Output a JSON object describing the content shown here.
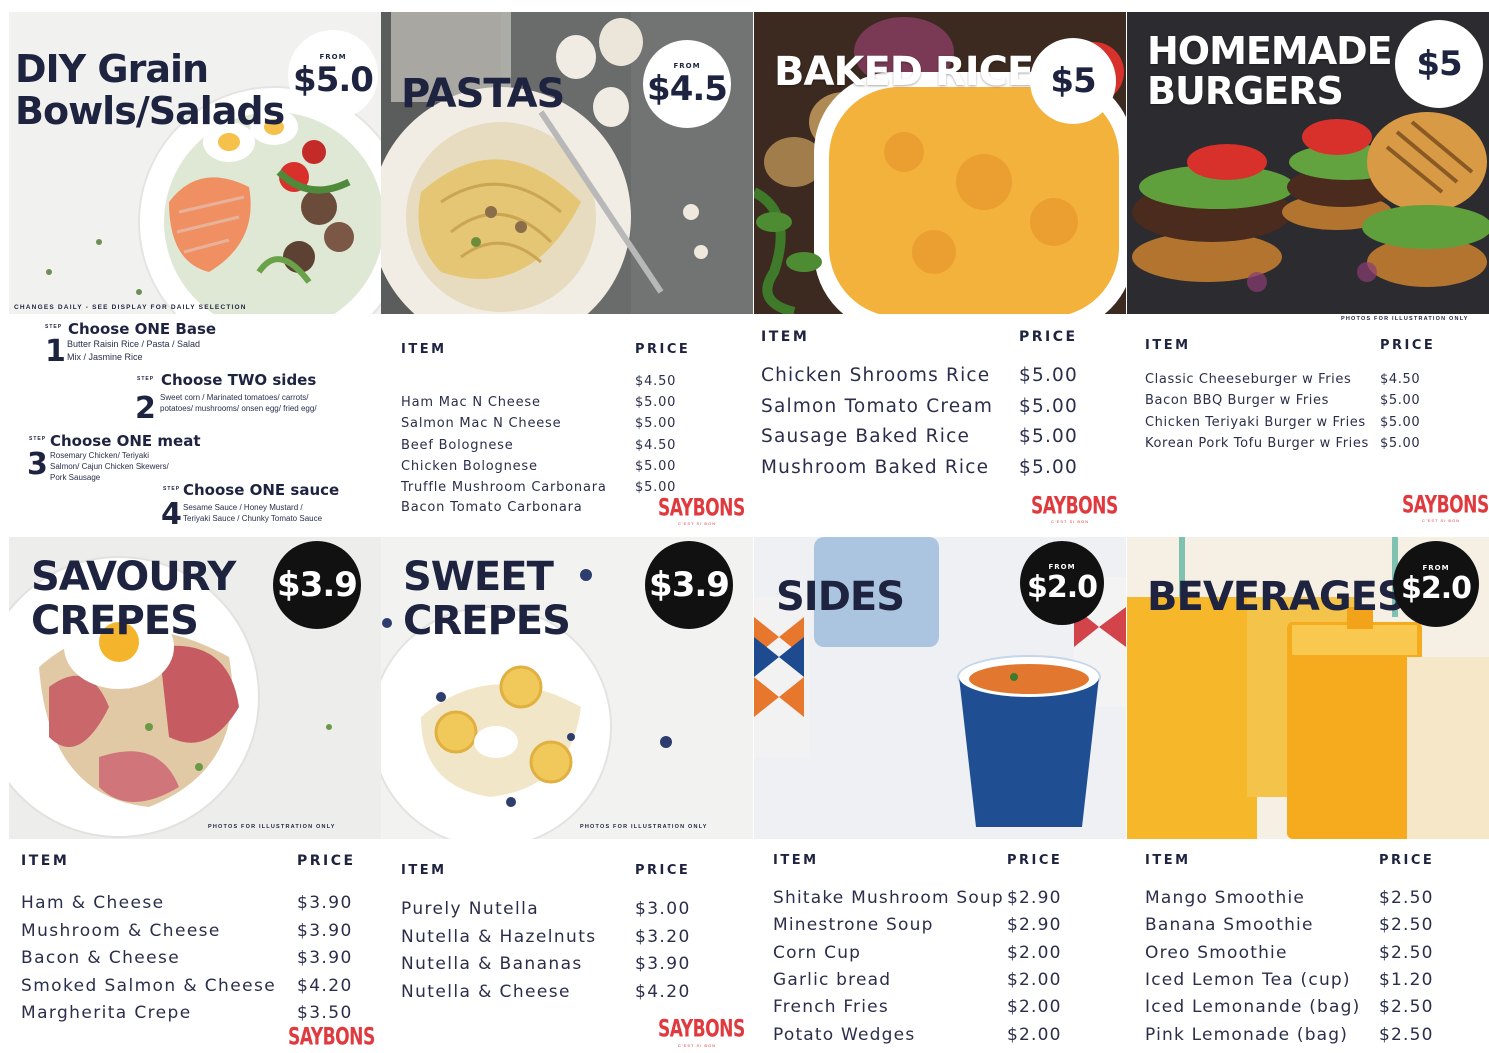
{
  "colors": {
    "navy": "#1e2340",
    "brand_red": "#e03a3e",
    "badge_black": "#111111"
  },
  "brand": {
    "name": "SAYBONS",
    "tagline": "C'EST SI BON"
  },
  "panels": {
    "grain_bowls": {
      "title_line1": "DIY Grain",
      "title_line2": "Bowls/Salads",
      "badge_from": "FROM",
      "badge_price": "$5.0",
      "caption": "CHANGES DAILY - SEE DISPLAY FOR DAILY SELECTION",
      "step_label": "STEP",
      "steps": [
        {
          "num": "1",
          "title": "Choose ONE Base",
          "desc_line1": "Butter Raisin Rice / Pasta  / Salad",
          "desc_line2": "Mix / Jasmine Rice"
        },
        {
          "num": "2",
          "title": "Choose TWO sides",
          "desc_line1": "Sweet corn / Marinated tomatoes/ carrots/",
          "desc_line2": "potatoes/ mushrooms/ onsen egg/ fried egg/"
        },
        {
          "num": "3",
          "title": "Choose ONE meat",
          "desc_line1": "Rosemary Chicken/ Teriyaki",
          "desc_line2": "Salmon/ Cajun Chicken Skewers/",
          "desc_line3": "Pork Sausage"
        },
        {
          "num": "4",
          "title": "Choose ONE sauce",
          "desc_line1": "Sesame Sauce / Honey Mustard /",
          "desc_line2": "Teriyaki Sauce / Chunky Tomato Sauce"
        }
      ]
    },
    "pastas": {
      "title": "PASTAS",
      "badge_from": "FROM",
      "badge_price": "$4.5",
      "item_header": "ITEM",
      "price_header": "PRICE",
      "items": [
        {
          "name": "",
          "price": "$4.50"
        },
        {
          "name": "Ham Mac N Cheese",
          "price": "$5.00"
        },
        {
          "name": "Salmon Mac N Cheese",
          "price": "$5.00"
        },
        {
          "name": "Beef Bolognese",
          "price": "$4.50"
        },
        {
          "name": "Chicken Bolognese",
          "price": "$5.00"
        },
        {
          "name": "Truffle Mushroom Carbonara",
          "price": "$5.00"
        },
        {
          "name": "Bacon Tomato Carbonara",
          "price": ""
        }
      ]
    },
    "baked_rice": {
      "title": "BAKED RICE",
      "badge_price": "$5",
      "item_header": "ITEM",
      "price_header": "PRICE",
      "items": [
        {
          "name": "Chicken Shrooms Rice",
          "price": "$5.00"
        },
        {
          "name": "Salmon Tomato Cream",
          "price": "$5.00"
        },
        {
          "name": "Sausage Baked Rice",
          "price": "$5.00"
        },
        {
          "name": "Mushroom Baked Rice",
          "price": "$5.00"
        }
      ]
    },
    "burgers": {
      "title_line1": "HOMEMADE",
      "title_line2": "BURGERS",
      "badge_price": "$5",
      "caption": "PHOTOS FOR ILLUSTRATION ONLY",
      "item_header": "ITEM",
      "price_header": "PRICE",
      "items": [
        {
          "name": "Classic Cheeseburger w Fries",
          "price": "$4.50"
        },
        {
          "name": "Bacon BBQ Burger w Fries",
          "price": "$5.00"
        },
        {
          "name": "Chicken Teriyaki Burger w Fries",
          "price": "$5.00"
        },
        {
          "name": "Korean Pork Tofu Burger w Fries",
          "price": "$5.00"
        }
      ]
    },
    "savoury_crepes": {
      "title_line1": "SAVOURY",
      "title_line2": "CREPES",
      "badge_price": "$3.9",
      "caption": "PHOTOS FOR ILLUSTRATION ONLY",
      "item_header": "ITEM",
      "price_header": "PRICE",
      "items": [
        {
          "name": "Ham & Cheese",
          "price": "$3.90"
        },
        {
          "name": "Mushroom & Cheese",
          "price": "$3.90"
        },
        {
          "name": "Bacon & Cheese",
          "price": "$3.90"
        },
        {
          "name": "Smoked Salmon & Cheese",
          "price": "$4.20"
        },
        {
          "name": "Margherita Crepe",
          "price": "$3.50"
        }
      ]
    },
    "sweet_crepes": {
      "title_line1": "SWEET",
      "title_line2": "CREPES",
      "badge_price": "$3.9",
      "caption": "PHOTOS FOR ILLUSTRATION ONLY",
      "item_header": "ITEM",
      "price_header": "PRICE",
      "items": [
        {
          "name": "Purely Nutella",
          "price": "$3.00"
        },
        {
          "name": "Nutella & Hazelnuts",
          "price": "$3.20"
        },
        {
          "name": "Nutella & Bananas",
          "price": "$3.90"
        },
        {
          "name": "Nutella & Cheese",
          "price": "$4.20"
        }
      ]
    },
    "sides": {
      "title": "SIDES",
      "badge_from": "FROM",
      "badge_price": "$2.0",
      "item_header": "ITEM",
      "price_header": "PRICE",
      "items": [
        {
          "name": "Shitake Mushroom Soup",
          "price": "$2.90"
        },
        {
          "name": "Minestrone Soup",
          "price": "$2.90"
        },
        {
          "name": "Corn Cup",
          "price": "$2.00"
        },
        {
          "name": "Garlic bread",
          "price": "$2.00"
        },
        {
          "name": "French Fries",
          "price": "$2.00"
        },
        {
          "name": "Potato Wedges",
          "price": "$2.00"
        }
      ]
    },
    "beverages": {
      "title": "BEVERAGES",
      "badge_from": "FROM",
      "badge_price": "$2.0",
      "item_header": "ITEM",
      "price_header": "PRICE",
      "items": [
        {
          "name": "Mango Smoothie",
          "price": "$2.50"
        },
        {
          "name": "Banana Smoothie",
          "price": "$2.50"
        },
        {
          "name": "Oreo Smoothie",
          "price": "$2.50"
        },
        {
          "name": "Iced Lemon Tea (cup)",
          "price": "$1.20"
        },
        {
          "name": "Iced Lemonande (bag)",
          "price": "$2.50"
        },
        {
          "name": "Pink Lemonade (bag)",
          "price": "$2.50"
        }
      ]
    }
  }
}
